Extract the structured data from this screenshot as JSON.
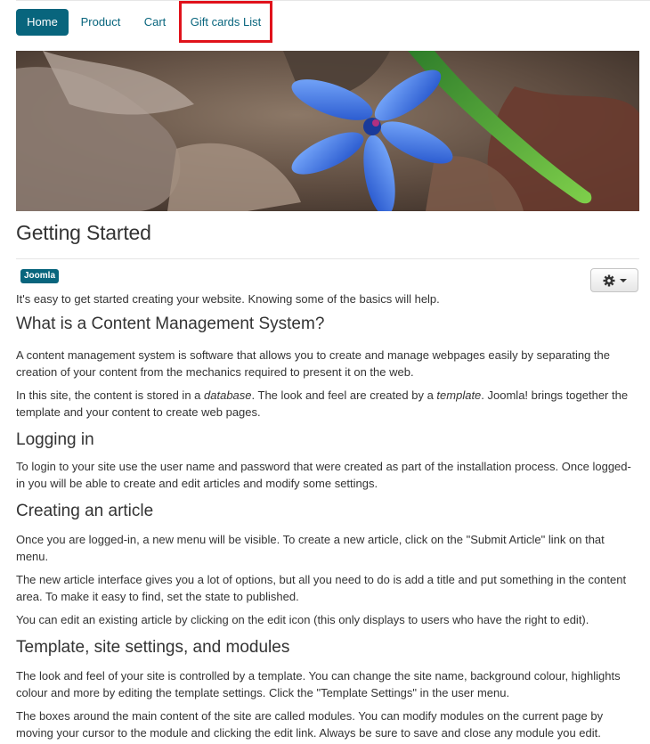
{
  "nav": {
    "items": [
      "Home",
      "Product",
      "Cart",
      "Gift cards List"
    ]
  },
  "colors": {
    "accent": "#08657d",
    "highlight_box": "#e0121b"
  },
  "article": {
    "title": "Getting Started",
    "category_badge": "Joomla",
    "tools_icon": "gear-icon",
    "intro": "It's easy to get started creating your website. Knowing some of the basics will help.",
    "sections": [
      {
        "heading": "What is a Content Management System?",
        "p1": "A content management system is software that allows you to create and manage webpages easily by separating the creation of your content from the mechanics required to present it on the web.",
        "p2_a": "In this site, the content is stored in a ",
        "p2_em1": "database",
        "p2_b": ". The look and feel are created by a ",
        "p2_em2": "template",
        "p2_c": ". Joomla! brings together the template and your content to create web pages."
      },
      {
        "heading": "Logging in",
        "p1": "To login to your site use the user name and password that were created as part of the installation process. Once logged-in you will be able to create and edit articles and modify some settings."
      },
      {
        "heading": "Creating an article",
        "p1": "Once you are logged-in, a new menu will be visible. To create a new article, click on the \"Submit Article\" link on that menu.",
        "p2": "The new article interface gives you a lot of options, but all you need to do is add a title and put something in the content area. To make it easy to find, set the state to published.",
        "p3": "You can edit an existing article by clicking on the edit icon (this only displays to users who have the right to edit)."
      },
      {
        "heading": "Template, site settings, and modules",
        "p1": "The look and feel of your site is controlled by a template. You can change the site name, background colour, highlights colour and more by editing the template settings. Click the \"Template Settings\" in the user menu.",
        "p2": "The boxes around the main content of the site are called modules. You can modify modules on the current page by moving your cursor to the module and clicking the edit link. Always be sure to save and close any module you edit."
      }
    ]
  }
}
